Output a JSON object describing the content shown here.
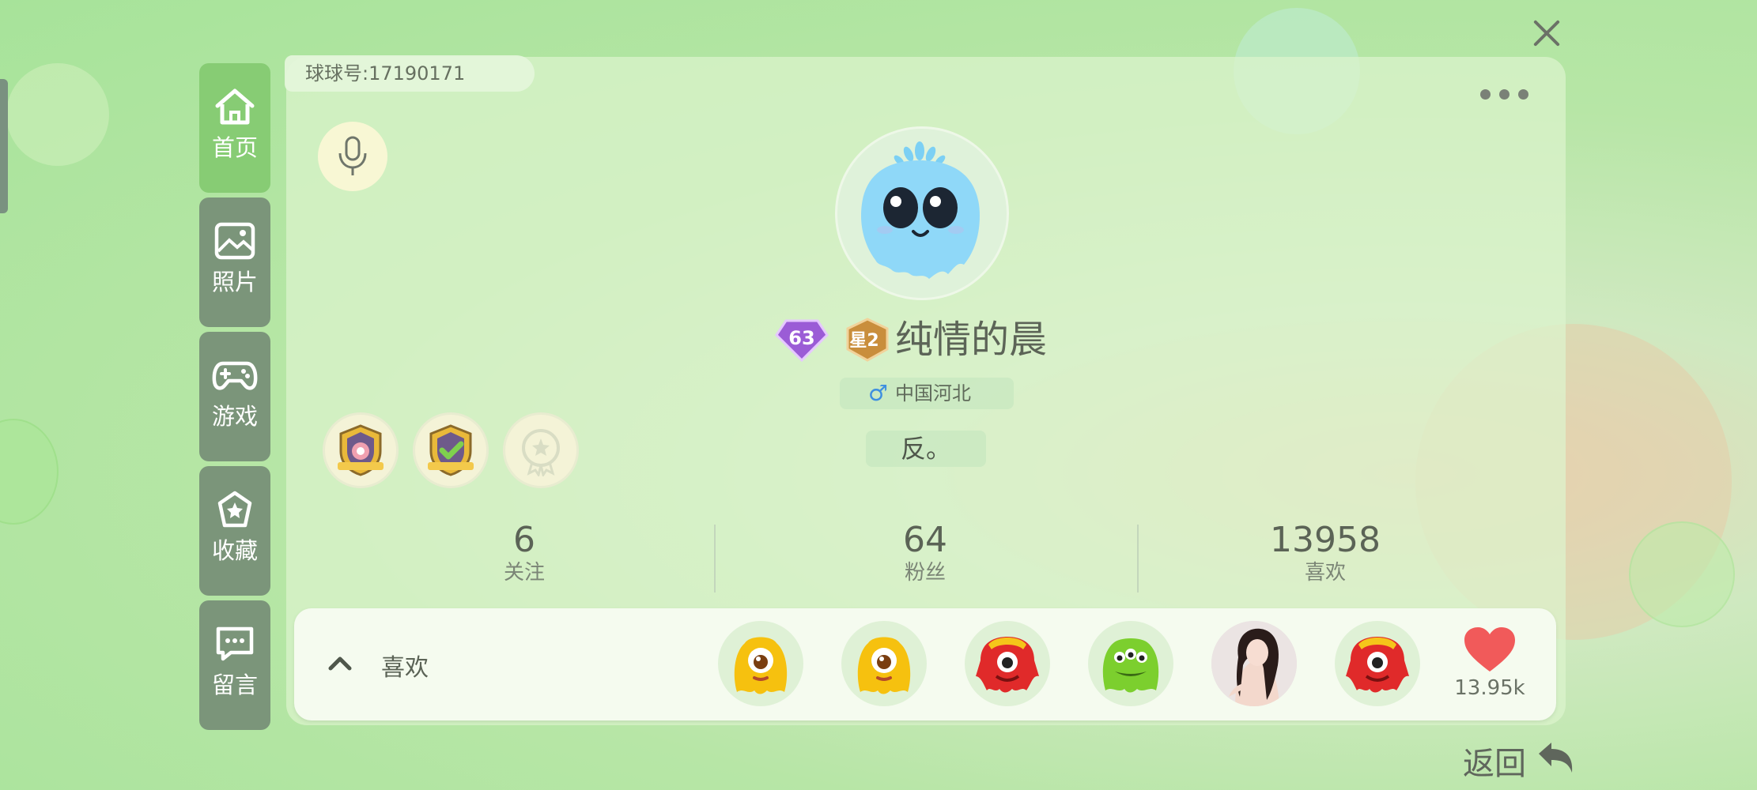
{
  "close_icon": "close-icon",
  "sidebar": {
    "items": [
      {
        "label": "首页",
        "icon": "home-icon",
        "active": true
      },
      {
        "label": "照片",
        "icon": "image-icon",
        "active": false
      },
      {
        "label": "游戏",
        "icon": "gamepad-icon",
        "active": false
      },
      {
        "label": "收藏",
        "icon": "star-icon",
        "active": false
      },
      {
        "label": "留言",
        "icon": "message-icon",
        "active": false
      }
    ]
  },
  "profile": {
    "id_text": "球球号:17190171",
    "level": "63",
    "rank_badge": "星2",
    "nickname": "纯情的晨",
    "gender_symbol": "♂",
    "location": "中国河北",
    "signature": "反。"
  },
  "stats": [
    {
      "value": "6",
      "label": "关注"
    },
    {
      "value": "64",
      "label": "粉丝"
    },
    {
      "value": "13958",
      "label": "喜欢"
    }
  ],
  "likes": {
    "label": "喜欢",
    "count": "13.95k",
    "likers": [
      "yellow-monster",
      "yellow-monster",
      "red-monster",
      "green-monster",
      "photo-avatar",
      "red-monster"
    ]
  },
  "back_label": "返回",
  "colors": {
    "accent_green": "#87cc74",
    "sidebar_gray_green": "#7b957a",
    "heart_red": "#f15a5a"
  }
}
